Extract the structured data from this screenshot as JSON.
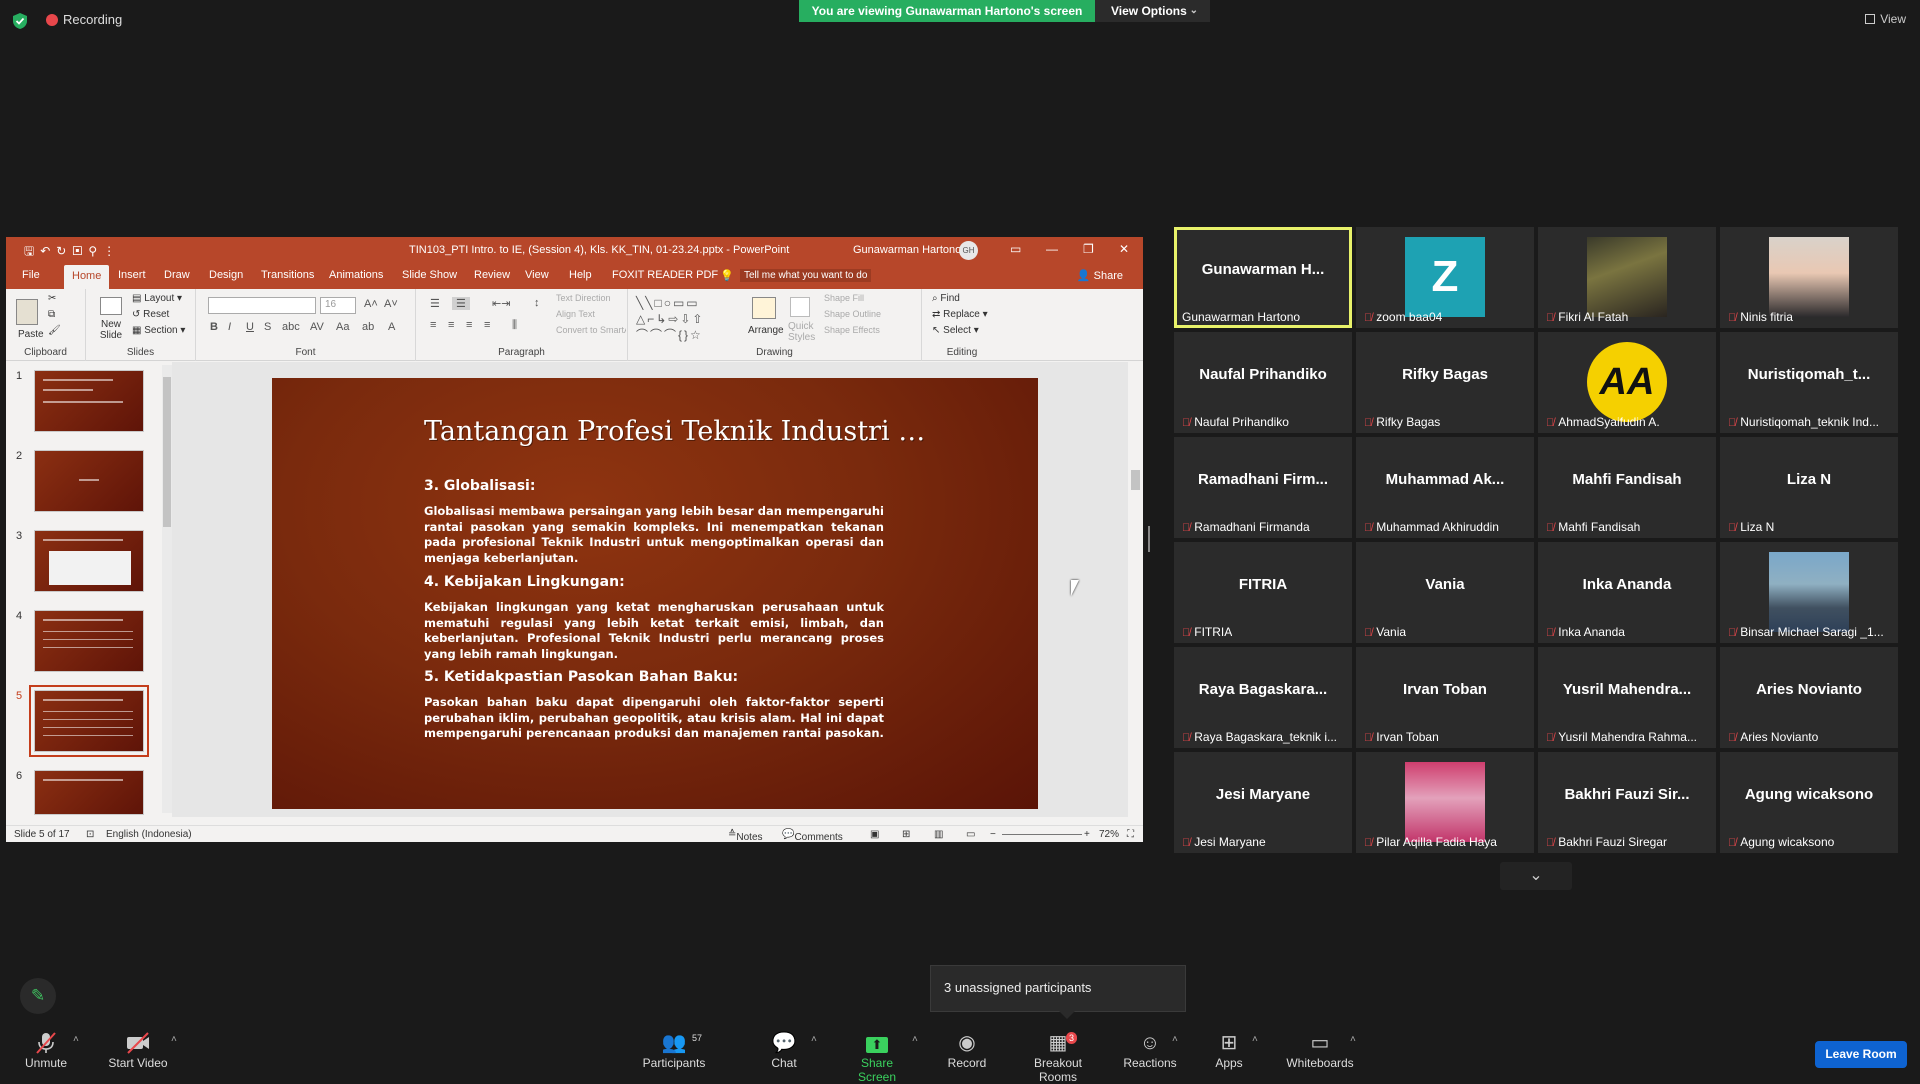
{
  "top": {
    "recording": "Recording",
    "viewing_banner": "You are viewing Gunawarman Hartono's screen",
    "view_options": "View Options",
    "view": "View"
  },
  "ppt": {
    "filename": "TIN103_PTI Intro. to IE, (Session 4), Kls. KK_TIN, 01-23.24.pptx - PowerPoint",
    "user": "Gunawarman Hartono",
    "user_initials": "GH",
    "tabs": [
      "File",
      "Home",
      "Insert",
      "Draw",
      "Design",
      "Transitions",
      "Animations",
      "Slide Show",
      "Review",
      "View",
      "Help",
      "FOXIT READER PDF"
    ],
    "tell_me": "Tell me what you want to do",
    "share": "Share",
    "ribbon": {
      "paste": "Paste",
      "clipboard": "Clipboard",
      "new_slide": "New\nSlide",
      "layout": "Layout",
      "reset": "Reset",
      "section": "Section",
      "slides": "Slides",
      "font_size": "16",
      "font": "Font",
      "text_direction": "Text Direction",
      "align_text": "Align Text",
      "convert_smartart": "Convert to SmartArt",
      "paragraph": "Paragraph",
      "arrange": "Arrange",
      "quick_styles": "Quick\nStyles",
      "shape_fill": "Shape Fill",
      "shape_outline": "Shape Outline",
      "shape_effects": "Shape Effects",
      "drawing": "Drawing",
      "find": "Find",
      "replace": "Replace",
      "select": "Select",
      "editing": "Editing"
    },
    "thumbs": [
      "1",
      "2",
      "3",
      "4",
      "5",
      "6"
    ],
    "slide": {
      "title": "Tantangan Profesi Teknik Industri …",
      "h1": "3. Globalisasi:",
      "p1": "Globalisasi membawa persaingan yang lebih besar dan mempengaruhi rantai pasokan yang semakin kompleks. Ini menempatkan tekanan pada profesional Teknik Industri untuk mengoptimalkan operasi dan menjaga keberlanjutan.",
      "h2": "4. Kebijakan Lingkungan:",
      "p2": "Kebijakan lingkungan yang ketat mengharuskan perusahaan untuk mematuhi regulasi yang lebih ketat terkait emisi, limbah, dan keberlanjutan. Profesional Teknik Industri perlu merancang proses yang lebih ramah lingkungan.",
      "h3": "5. Ketidakpastian Pasokan Bahan Baku:",
      "p3": "Pasokan bahan baku dapat dipengaruhi oleh faktor-faktor seperti perubahan iklim, perubahan geopolitik, atau krisis alam. Hal ini dapat mempengaruhi perencanaan produksi dan manajemen rantai pasokan."
    },
    "status": {
      "slide_of": "Slide 5 of 17",
      "language": "English (Indonesia)",
      "notes": "Notes",
      "comments": "Comments",
      "zoom": "72%"
    }
  },
  "gallery": [
    {
      "name": "Gunawarman  H...",
      "label": "Gunawarman Hartono",
      "active": true,
      "muted": false
    },
    {
      "name": "",
      "label": "zoom baa04",
      "pic": "z",
      "pic_text": "Z",
      "muted": true
    },
    {
      "name": "",
      "label": "Fikri Al Fatah",
      "pic": "ph1",
      "muted": true
    },
    {
      "name": "",
      "label": "Ninis fitria",
      "pic": "ph2",
      "muted": true
    },
    {
      "name": "Naufal Prihandiko",
      "label": "Naufal Prihandiko",
      "muted": true
    },
    {
      "name": "Rifky Bagas",
      "label": "Rifky Bagas",
      "muted": true
    },
    {
      "name": "",
      "label": "AhmadSyaifudin A.",
      "pic": "aa",
      "pic_text": "AA",
      "muted": true
    },
    {
      "name": "Nuristiqomah_t...",
      "label": "Nuristiqomah_teknik Ind...",
      "muted": true
    },
    {
      "name": "Ramadhani  Firm...",
      "label": "Ramadhani Firmanda",
      "muted": true
    },
    {
      "name": "Muhammad  Ak...",
      "label": "Muhammad Akhiruddin",
      "muted": true
    },
    {
      "name": "Mahfi Fandisah",
      "label": "Mahfi Fandisah",
      "muted": true
    },
    {
      "name": "Liza N",
      "label": "Liza N",
      "muted": true
    },
    {
      "name": "FITRIA",
      "label": "FITRIA",
      "muted": true
    },
    {
      "name": "Vania",
      "label": "Vania",
      "muted": true
    },
    {
      "name": "Inka Ananda",
      "label": "Inka Ananda",
      "muted": true
    },
    {
      "name": "",
      "label": "Binsar Michael Saragi _1...",
      "pic": "ph3",
      "muted": true
    },
    {
      "name": "Raya  Bagaskara...",
      "label": "Raya Bagaskara_teknik i...",
      "muted": true
    },
    {
      "name": "Irvan Toban",
      "label": "Irvan Toban",
      "muted": true
    },
    {
      "name": "Yusril  Mahendra...",
      "label": "Yusril Mahendra Rahma...",
      "muted": true
    },
    {
      "name": "Aries Novianto",
      "label": "Aries Novianto",
      "muted": true
    },
    {
      "name": "Jesi Maryane",
      "label": "Jesi Maryane",
      "muted": true
    },
    {
      "name": "",
      "label": "Pilar Aqilla Fadia Haya",
      "pic": "ph4",
      "muted": true
    },
    {
      "name": "Bakhri  Fauzi  Sir...",
      "label": "Bakhri Fauzi Siregar",
      "muted": true
    },
    {
      "name": "Agung wicaksono",
      "label": "Agung wicaksono",
      "muted": true
    }
  ],
  "tooltip": "3 unassigned participants",
  "toolbar": {
    "unmute": "Unmute",
    "start_video": "Start Video",
    "participants": "Participants",
    "participants_count": "57",
    "chat": "Chat",
    "share_screen": "Share Screen",
    "record": "Record",
    "breakout_rooms": "Breakout Rooms",
    "breakout_badge": "3",
    "reactions": "Reactions",
    "apps": "Apps",
    "whiteboards": "Whiteboards",
    "leave": "Leave Room"
  },
  "colors": {
    "ppt_accent": "#b7472a",
    "zoom_green": "#27ae60",
    "active_speaker": "#e8f26a",
    "leave_blue": "#0e63d1",
    "muted_red": "#e8474b"
  }
}
